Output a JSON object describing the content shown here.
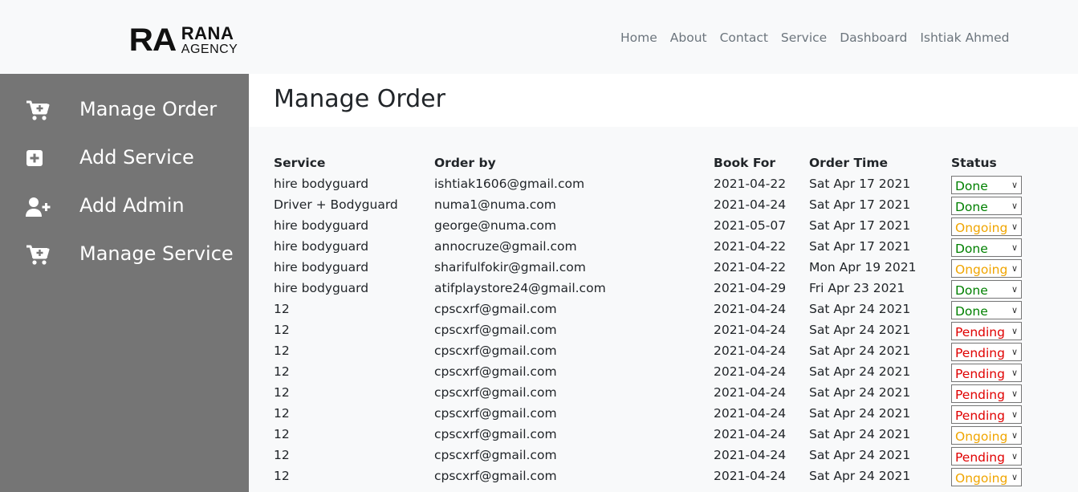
{
  "brand": {
    "mark": "RA",
    "line1": "RANA",
    "line2": "AGENCY"
  },
  "nav": [
    "Home",
    "About",
    "Contact",
    "Service",
    "Dashboard",
    "Ishtiak Ahmed"
  ],
  "sidebar": [
    {
      "label": "Manage Order",
      "icon": "cart-plus-icon"
    },
    {
      "label": "Add Service",
      "icon": "plus-square-icon"
    },
    {
      "label": "Add Admin",
      "icon": "user-plus-icon"
    },
    {
      "label": "Manage Service",
      "icon": "cart-plus-icon"
    }
  ],
  "page_title": "Manage Order",
  "table": {
    "headers": [
      "Service",
      "Order by",
      "Book For",
      "Order Time",
      "Status"
    ],
    "rows": [
      [
        "hire bodyguard",
        "ishtiak1606@gmail.com",
        "2021-04-22",
        "Sat Apr 17 2021",
        "Done"
      ],
      [
        "Driver + Bodyguard",
        "numa1@numa.com",
        "2021-04-24",
        "Sat Apr 17 2021",
        "Done"
      ],
      [
        "hire bodyguard",
        "george@numa.com",
        "2021-05-07",
        "Sat Apr 17 2021",
        "Ongoing"
      ],
      [
        "hire bodyguard",
        "annocruze@gmail.com",
        "2021-04-22",
        "Sat Apr 17 2021",
        "Done"
      ],
      [
        "hire bodyguard",
        "sharifulfokir@gmail.com",
        "2021-04-22",
        "Mon Apr 19 2021",
        "Ongoing"
      ],
      [
        "hire bodyguard",
        "atifplaystore24@gmail.com",
        "2021-04-29",
        "Fri Apr 23 2021",
        "Done"
      ],
      [
        "12",
        "cpscxrf@gmail.com",
        "2021-04-24",
        "Sat Apr 24 2021",
        "Done"
      ],
      [
        "12",
        "cpscxrf@gmail.com",
        "2021-04-24",
        "Sat Apr 24 2021",
        "Pending"
      ],
      [
        "12",
        "cpscxrf@gmail.com",
        "2021-04-24",
        "Sat Apr 24 2021",
        "Pending"
      ],
      [
        "12",
        "cpscxrf@gmail.com",
        "2021-04-24",
        "Sat Apr 24 2021",
        "Pending"
      ],
      [
        "12",
        "cpscxrf@gmail.com",
        "2021-04-24",
        "Sat Apr 24 2021",
        "Pending"
      ],
      [
        "12",
        "cpscxrf@gmail.com",
        "2021-04-24",
        "Sat Apr 24 2021",
        "Pending"
      ],
      [
        "12",
        "cpscxrf@gmail.com",
        "2021-04-24",
        "Sat Apr 24 2021",
        "Ongoing"
      ],
      [
        "12",
        "cpscxrf@gmail.com",
        "2021-04-24",
        "Sat Apr 24 2021",
        "Pending"
      ],
      [
        "12",
        "cpscxrf@gmail.com",
        "2021-04-24",
        "Sat Apr 24 2021",
        "Ongoing"
      ]
    ]
  },
  "status_colors": {
    "Done": "#008000",
    "Ongoing": "#f0a500",
    "Pending": "#e00000"
  }
}
